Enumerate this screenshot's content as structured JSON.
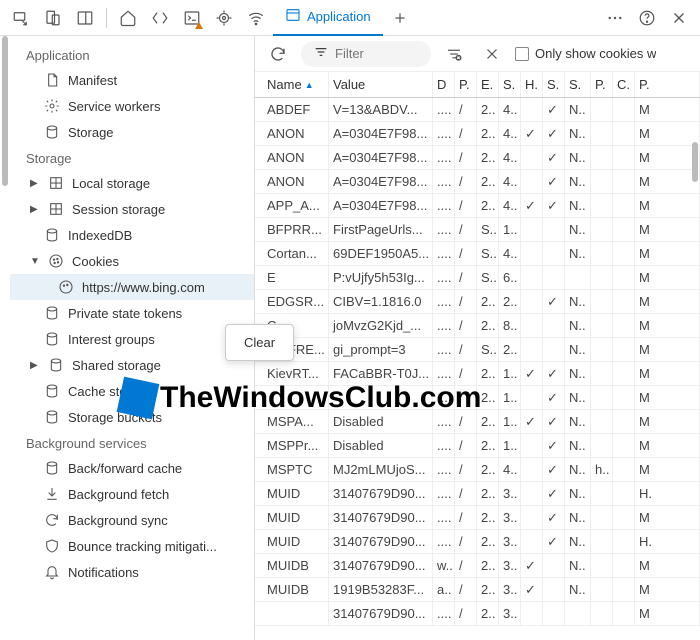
{
  "toolbar": {
    "active_tab_label": "Application"
  },
  "filterbar": {
    "filter_placeholder": "Filter",
    "only_cookies_label": "Only show cookies w"
  },
  "sidebar": {
    "section1": "Application",
    "section2": "Storage",
    "section3": "Background services",
    "app_items": [
      "Manifest",
      "Service workers",
      "Storage"
    ],
    "storage_items": [
      "Local storage",
      "Session storage",
      "IndexedDB",
      "Cookies",
      "Private state tokens",
      "Interest groups",
      "Shared storage",
      "Cache storage",
      "Storage buckets"
    ],
    "cookie_origin": "https://www.bing.com",
    "bg_items": [
      "Back/forward cache",
      "Background fetch",
      "Background sync",
      "Bounce tracking mitigati...",
      "Notifications"
    ]
  },
  "context_menu": {
    "clear": "Clear"
  },
  "table": {
    "headers": [
      "Name",
      "Value",
      "D",
      "P.",
      "E.",
      "S.",
      "H.",
      "S.",
      "S.",
      "P.",
      "C.",
      "P."
    ],
    "rows": [
      {
        "name": "ABDEF",
        "value": "V=13&ABDV...",
        "d": "....",
        "p": "/",
        "e": "2..",
        "s": "4..",
        "h": "",
        "s2": "✓",
        "s3": "N..",
        "p2": "",
        "c": "",
        "p3": "M"
      },
      {
        "name": "ANON",
        "value": "A=0304E7F98...",
        "d": "....",
        "p": "/",
        "e": "2..",
        "s": "4..",
        "h": "✓",
        "s2": "✓",
        "s3": "N..",
        "p2": "",
        "c": "",
        "p3": "M"
      },
      {
        "name": "ANON",
        "value": "A=0304E7F98...",
        "d": "....",
        "p": "/",
        "e": "2..",
        "s": "4..",
        "h": "",
        "s2": "✓",
        "s3": "N..",
        "p2": "",
        "c": "",
        "p3": "M"
      },
      {
        "name": "ANON",
        "value": "A=0304E7F98...",
        "d": "....",
        "p": "/",
        "e": "2..",
        "s": "4..",
        "h": "",
        "s2": "✓",
        "s3": "N..",
        "p2": "",
        "c": "",
        "p3": "M"
      },
      {
        "name": "APP_A...",
        "value": "A=0304E7F98...",
        "d": "....",
        "p": "/",
        "e": "2..",
        "s": "4..",
        "h": "✓",
        "s2": "✓",
        "s3": "N..",
        "p2": "",
        "c": "",
        "p3": "M"
      },
      {
        "name": "BFPRR...",
        "value": "FirstPageUrls...",
        "d": "....",
        "p": "/",
        "e": "S..",
        "s": "1..",
        "h": "",
        "s2": "",
        "s3": "N..",
        "p2": "",
        "c": "",
        "p3": "M"
      },
      {
        "name": "Cortan...",
        "value": "69DEF1950A5...",
        "d": "....",
        "p": "/",
        "e": "S..",
        "s": "4..",
        "h": "",
        "s2": "",
        "s3": "N..",
        "p2": "",
        "c": "",
        "p3": "M"
      },
      {
        "name": "E",
        "value": "P:vUjfy5h53Ig...",
        "d": "....",
        "p": "/",
        "e": "S..",
        "s": "6..",
        "h": "",
        "s2": "",
        "s3": "",
        "p2": "",
        "c": "",
        "p3": "M"
      },
      {
        "name": "EDGSR...",
        "value": "CIBV=1.1816.0",
        "d": "....",
        "p": "/",
        "e": "2..",
        "s": "2..",
        "h": "",
        "s2": "✓",
        "s3": "N..",
        "p2": "",
        "c": "",
        "p3": "M"
      },
      {
        "name": "C",
        "value": "joMvzG2Kjd_...",
        "d": "....",
        "p": "/",
        "e": "2..",
        "s": "8..",
        "h": "",
        "s2": "",
        "s3": "N..",
        "p2": "",
        "c": "",
        "p3": "M"
      },
      {
        "name": "GI_FRE...",
        "value": "gi_prompt=3",
        "d": "....",
        "p": "/",
        "e": "S..",
        "s": "2..",
        "h": "",
        "s2": "",
        "s3": "N..",
        "p2": "",
        "c": "",
        "p3": "M"
      },
      {
        "name": "KievRT...",
        "value": "FACaBBR-T0J...",
        "d": "....",
        "p": "/",
        "e": "2..",
        "s": "1..",
        "h": "✓",
        "s2": "✓",
        "s3": "N..",
        "p2": "",
        "c": "",
        "p3": "M"
      },
      {
        "name": "",
        "value": "",
        "d": "....",
        "p": "/",
        "e": "2..",
        "s": "1..",
        "h": "",
        "s2": "✓",
        "s3": "N..",
        "p2": "",
        "c": "",
        "p3": "M"
      },
      {
        "name": "MSPA...",
        "value": "Disabled",
        "d": "....",
        "p": "/",
        "e": "2..",
        "s": "1..",
        "h": "✓",
        "s2": "✓",
        "s3": "N..",
        "p2": "",
        "c": "",
        "p3": "M"
      },
      {
        "name": "MSPPr...",
        "value": "Disabled",
        "d": "....",
        "p": "/",
        "e": "2..",
        "s": "1..",
        "h": "",
        "s2": "✓",
        "s3": "N..",
        "p2": "",
        "c": "",
        "p3": "M"
      },
      {
        "name": "MSPTC",
        "value": "MJ2mLMUjoS...",
        "d": "....",
        "p": "/",
        "e": "2..",
        "s": "4..",
        "h": "",
        "s2": "✓",
        "s3": "N..",
        "p2": "h..",
        "c": "",
        "p3": "M"
      },
      {
        "name": "MUID",
        "value": "31407679D90...",
        "d": "....",
        "p": "/",
        "e": "2..",
        "s": "3..",
        "h": "",
        "s2": "✓",
        "s3": "N..",
        "p2": "",
        "c": "",
        "p3": "H."
      },
      {
        "name": "MUID",
        "value": "31407679D90...",
        "d": "....",
        "p": "/",
        "e": "2..",
        "s": "3..",
        "h": "",
        "s2": "✓",
        "s3": "N..",
        "p2": "",
        "c": "",
        "p3": "M"
      },
      {
        "name": "MUID",
        "value": "31407679D90...",
        "d": "....",
        "p": "/",
        "e": "2..",
        "s": "3..",
        "h": "",
        "s2": "✓",
        "s3": "N..",
        "p2": "",
        "c": "",
        "p3": "H."
      },
      {
        "name": "MUIDB",
        "value": "31407679D90...",
        "d": "w..",
        "p": "/",
        "e": "2..",
        "s": "3..",
        "h": "✓",
        "s2": "",
        "s3": "N..",
        "p2": "",
        "c": "",
        "p3": "M"
      },
      {
        "name": "MUIDB",
        "value": "1919B53283F...",
        "d": "a..",
        "p": "/",
        "e": "2..",
        "s": "3..",
        "h": "✓",
        "s2": "",
        "s3": "N..",
        "p2": "",
        "c": "",
        "p3": "M"
      },
      {
        "name": "",
        "value": "31407679D90...",
        "d": "....",
        "p": "/",
        "e": "2..",
        "s": "3..",
        "h": "",
        "s2": "",
        "s3": "",
        "p2": "",
        "c": "",
        "p3": "M"
      }
    ]
  },
  "watermark": "TheWindowsClub.com"
}
